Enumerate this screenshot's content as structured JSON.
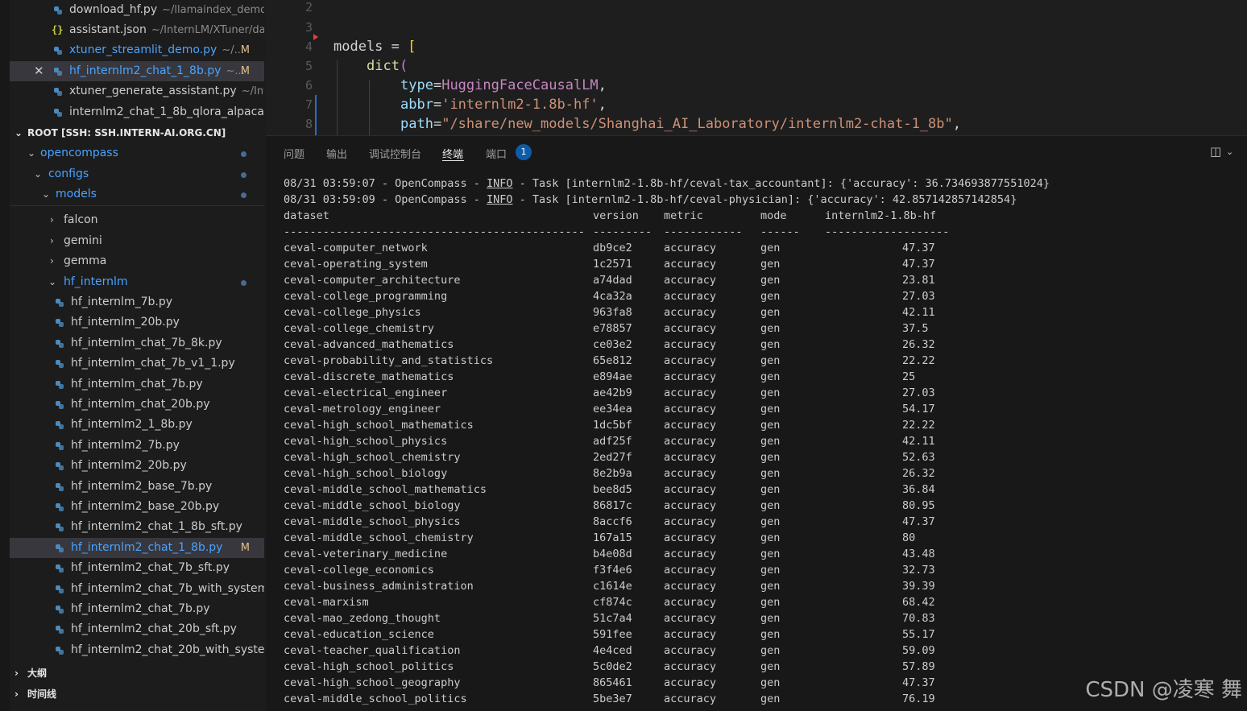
{
  "sidebar": {
    "open_editors": [
      {
        "name": "download_hf.py",
        "path": "~/llamaindex_demo",
        "icon": "python-icon",
        "modified": "",
        "close": false
      },
      {
        "name": "assistant.json",
        "path": "~/InternLM/XTuner/da...",
        "icon": "json-icon",
        "modified": "",
        "close": false
      },
      {
        "name": "xtuner_streamlit_demo.py",
        "path": "~/...",
        "icon": "python-icon",
        "modified": "M",
        "close": false
      },
      {
        "name": "hf_internlm2_chat_1_8b.py",
        "path": "~...",
        "icon": "python-icon",
        "modified": "M",
        "close": true
      },
      {
        "name": "xtuner_generate_assistant.py",
        "path": "~/Int...",
        "icon": "python-icon",
        "modified": "",
        "close": false
      },
      {
        "name": "internlm2_chat_1_8b_qlora_alpaca...",
        "path": "",
        "icon": "python-icon",
        "modified": "",
        "close": false
      }
    ],
    "root_label": "ROOT [SSH: SSH.INTERN-AI.ORG.CN]",
    "folders": [
      {
        "name": "opencompass",
        "level": 1
      },
      {
        "name": "configs",
        "level": 2
      },
      {
        "name": "models",
        "level": 3
      }
    ],
    "subfolders": [
      "falcon",
      "gemini",
      "gemma"
    ],
    "hf_folder": "hf_internlm",
    "files": [
      "hf_internlm_7b.py",
      "hf_internlm_20b.py",
      "hf_internlm_chat_7b_8k.py",
      "hf_internlm_chat_7b_v1_1.py",
      "hf_internlm_chat_7b.py",
      "hf_internlm_chat_20b.py",
      "hf_internlm2_1_8b.py",
      "hf_internlm2_7b.py",
      "hf_internlm2_20b.py",
      "hf_internlm2_base_7b.py",
      "hf_internlm2_base_20b.py",
      "hf_internlm2_chat_1_8b_sft.py",
      "hf_internlm2_chat_1_8b.py",
      "hf_internlm2_chat_7b_sft.py",
      "hf_internlm2_chat_7b_with_system...",
      "hf_internlm2_chat_7b.py",
      "hf_internlm2_chat_20b_sft.py",
      "hf_internlm2_chat_20b_with_syste..."
    ],
    "selected_file_modified": "M",
    "outline_label": "大纲",
    "timeline_label": "时间线"
  },
  "editor": {
    "line_numbers": [
      "2",
      "3",
      "4",
      "5",
      "6",
      "7",
      "8"
    ],
    "line4": {
      "ident": "models",
      "op": " = ",
      "br": "["
    },
    "line5": {
      "fn": "dict",
      "par": "("
    },
    "line6": {
      "param": "type",
      "op": "=",
      "value": "HuggingFaceCausalLM",
      "tail": ","
    },
    "line7": {
      "param": "abbr",
      "op": "=",
      "value": "'internlm2-1.8b-hf'",
      "tail": ","
    },
    "line8": {
      "param": "path",
      "op": "=",
      "value": "\"/share/new_models/Shanghai_AI_Laboratory/internlm2-chat-1_8b\"",
      "tail": ","
    }
  },
  "panel": {
    "tabs": [
      "问题",
      "输出",
      "调试控制台",
      "终端",
      "端口"
    ],
    "active_tab": "终端",
    "ports_badge": "1"
  },
  "terminal": {
    "log_lines": [
      {
        "prefix": "08/31 03:59:07 - OpenCompass - ",
        "level": "INFO",
        "msg": " - Task [internlm2-1.8b-hf/ceval-tax_accountant]: {'accuracy': 36.734693877551024}"
      },
      {
        "prefix": "08/31 03:59:09 - OpenCompass - ",
        "level": "INFO",
        "msg": " - Task [internlm2-1.8b-hf/ceval-physician]: {'accuracy': 42.857142857142854}"
      }
    ],
    "header": {
      "dataset": "dataset",
      "version": "version",
      "metric": "metric",
      "mode": "mode",
      "model": "internlm2-1.8b-hf"
    },
    "divider": {
      "dataset": "----------------------------------------------",
      "version": "---------",
      "metric": "------------",
      "mode": "------",
      "model": "-------------------"
    },
    "rows": [
      {
        "dataset": "ceval-computer_network",
        "version": "db9ce2",
        "metric": "accuracy",
        "mode": "gen",
        "score": "47.37"
      },
      {
        "dataset": "ceval-operating_system",
        "version": "1c2571",
        "metric": "accuracy",
        "mode": "gen",
        "score": "47.37"
      },
      {
        "dataset": "ceval-computer_architecture",
        "version": "a74dad",
        "metric": "accuracy",
        "mode": "gen",
        "score": "23.81"
      },
      {
        "dataset": "ceval-college_programming",
        "version": "4ca32a",
        "metric": "accuracy",
        "mode": "gen",
        "score": "27.03"
      },
      {
        "dataset": "ceval-college_physics",
        "version": "963fa8",
        "metric": "accuracy",
        "mode": "gen",
        "score": "42.11"
      },
      {
        "dataset": "ceval-college_chemistry",
        "version": "e78857",
        "metric": "accuracy",
        "mode": "gen",
        "score": "37.5"
      },
      {
        "dataset": "ceval-advanced_mathematics",
        "version": "ce03e2",
        "metric": "accuracy",
        "mode": "gen",
        "score": "26.32"
      },
      {
        "dataset": "ceval-probability_and_statistics",
        "version": "65e812",
        "metric": "accuracy",
        "mode": "gen",
        "score": "22.22"
      },
      {
        "dataset": "ceval-discrete_mathematics",
        "version": "e894ae",
        "metric": "accuracy",
        "mode": "gen",
        "score": "25"
      },
      {
        "dataset": "ceval-electrical_engineer",
        "version": "ae42b9",
        "metric": "accuracy",
        "mode": "gen",
        "score": "27.03"
      },
      {
        "dataset": "ceval-metrology_engineer",
        "version": "ee34ea",
        "metric": "accuracy",
        "mode": "gen",
        "score": "54.17"
      },
      {
        "dataset": "ceval-high_school_mathematics",
        "version": "1dc5bf",
        "metric": "accuracy",
        "mode": "gen",
        "score": "22.22"
      },
      {
        "dataset": "ceval-high_school_physics",
        "version": "adf25f",
        "metric": "accuracy",
        "mode": "gen",
        "score": "42.11"
      },
      {
        "dataset": "ceval-high_school_chemistry",
        "version": "2ed27f",
        "metric": "accuracy",
        "mode": "gen",
        "score": "52.63"
      },
      {
        "dataset": "ceval-high_school_biology",
        "version": "8e2b9a",
        "metric": "accuracy",
        "mode": "gen",
        "score": "26.32"
      },
      {
        "dataset": "ceval-middle_school_mathematics",
        "version": "bee8d5",
        "metric": "accuracy",
        "mode": "gen",
        "score": "36.84"
      },
      {
        "dataset": "ceval-middle_school_biology",
        "version": "86817c",
        "metric": "accuracy",
        "mode": "gen",
        "score": "80.95"
      },
      {
        "dataset": "ceval-middle_school_physics",
        "version": "8accf6",
        "metric": "accuracy",
        "mode": "gen",
        "score": "47.37"
      },
      {
        "dataset": "ceval-middle_school_chemistry",
        "version": "167a15",
        "metric": "accuracy",
        "mode": "gen",
        "score": "80"
      },
      {
        "dataset": "ceval-veterinary_medicine",
        "version": "b4e08d",
        "metric": "accuracy",
        "mode": "gen",
        "score": "43.48"
      },
      {
        "dataset": "ceval-college_economics",
        "version": "f3f4e6",
        "metric": "accuracy",
        "mode": "gen",
        "score": "32.73"
      },
      {
        "dataset": "ceval-business_administration",
        "version": "c1614e",
        "metric": "accuracy",
        "mode": "gen",
        "score": "39.39"
      },
      {
        "dataset": "ceval-marxism",
        "version": "cf874c",
        "metric": "accuracy",
        "mode": "gen",
        "score": "68.42"
      },
      {
        "dataset": "ceval-mao_zedong_thought",
        "version": "51c7a4",
        "metric": "accuracy",
        "mode": "gen",
        "score": "70.83"
      },
      {
        "dataset": "ceval-education_science",
        "version": "591fee",
        "metric": "accuracy",
        "mode": "gen",
        "score": "55.17"
      },
      {
        "dataset": "ceval-teacher_qualification",
        "version": "4e4ced",
        "metric": "accuracy",
        "mode": "gen",
        "score": "59.09"
      },
      {
        "dataset": "ceval-high_school_politics",
        "version": "5c0de2",
        "metric": "accuracy",
        "mode": "gen",
        "score": "57.89"
      },
      {
        "dataset": "ceval-high_school_geography",
        "version": "865461",
        "metric": "accuracy",
        "mode": "gen",
        "score": "47.37"
      },
      {
        "dataset": "ceval-middle_school_politics",
        "version": "5be3e7",
        "metric": "accuracy",
        "mode": "gen",
        "score": "76.19"
      }
    ]
  },
  "watermark": "CSDN @凌寒 舞",
  "colors": {
    "accent": "#4aa3ff",
    "modified": "#e2c08d",
    "badge": "#0e5ca8"
  }
}
